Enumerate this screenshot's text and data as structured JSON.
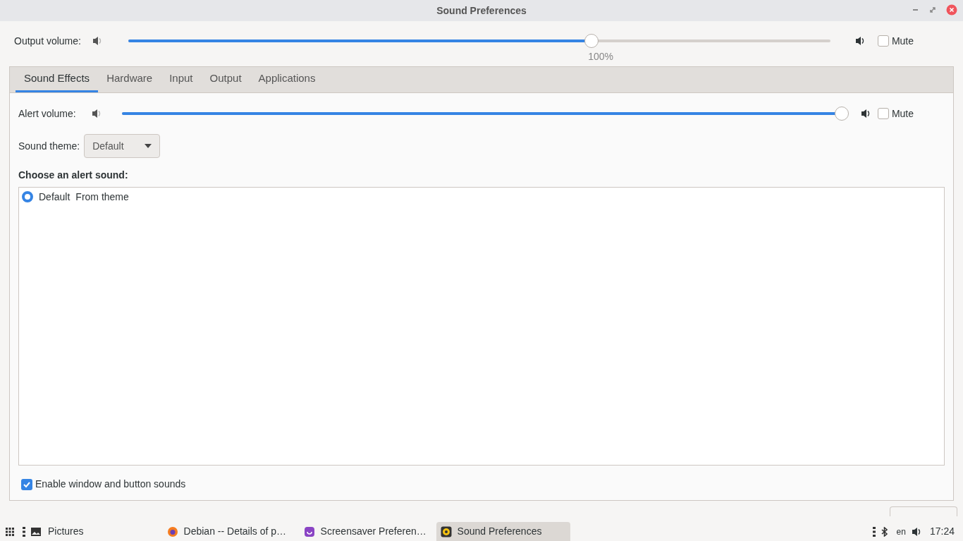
{
  "window": {
    "title": "Sound Preferences"
  },
  "output": {
    "label": "Output volume:",
    "level": 0.66,
    "reading": "100%",
    "mute_label": "Mute",
    "muted": false
  },
  "tabs": [
    {
      "label": "Sound Effects",
      "selected": true
    },
    {
      "label": "Hardware",
      "selected": false
    },
    {
      "label": "Input",
      "selected": false
    },
    {
      "label": "Output",
      "selected": false
    },
    {
      "label": "Applications",
      "selected": false
    }
  ],
  "alert": {
    "label": "Alert volume:",
    "level": 1,
    "mute_label": "Mute",
    "muted": false
  },
  "theme": {
    "label": "Sound theme:",
    "value": "Default"
  },
  "alert_sounds": {
    "heading": "Choose an alert sound:",
    "items": [
      {
        "name": "Default",
        "detail": "From theme",
        "selected": true
      }
    ]
  },
  "enable_sounds": {
    "label": "Enable window and button sounds",
    "checked": true
  },
  "taskbar": {
    "launcher": "Pictures",
    "tasks": [
      {
        "label": "Debian -- Details of p…",
        "kind": "browser",
        "selected": false
      },
      {
        "label": "Screensaver Preferen…",
        "kind": "screensaver",
        "selected": false
      },
      {
        "label": "Sound Preferences",
        "kind": "sound",
        "selected": true
      }
    ],
    "language": "en",
    "clock": "17:24"
  }
}
